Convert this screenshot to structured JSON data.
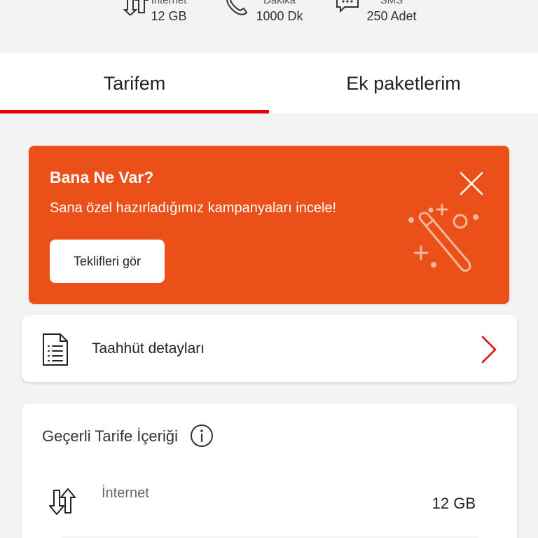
{
  "summary": {
    "items": [
      {
        "label": "İnternet",
        "value": "12 GB",
        "icon": "data-transfer-icon"
      },
      {
        "label": "Dakika",
        "value": "1000 Dk",
        "icon": "phone-icon"
      },
      {
        "label": "SMS",
        "value": "250 Adet",
        "icon": "message-icon"
      }
    ]
  },
  "tabs": [
    {
      "label": "Tarifem",
      "active": true
    },
    {
      "label": "Ek paketlerim",
      "active": false
    }
  ],
  "promo": {
    "title": "Bana Ne Var?",
    "subtitle": "Sana özel hazırladığımız kampanyaları incele!",
    "button_label": "Teklifleri gör",
    "background": "#eb5018"
  },
  "commitment": {
    "label": "Taahhüt detayları"
  },
  "tariff": {
    "title": "Geçerli Tarife İçeriği",
    "rows": [
      {
        "label": "İnternet",
        "value": "12 GB",
        "icon": "data-transfer-icon"
      }
    ]
  },
  "colors": {
    "accent": "#e60000",
    "promo": "#eb5018"
  }
}
